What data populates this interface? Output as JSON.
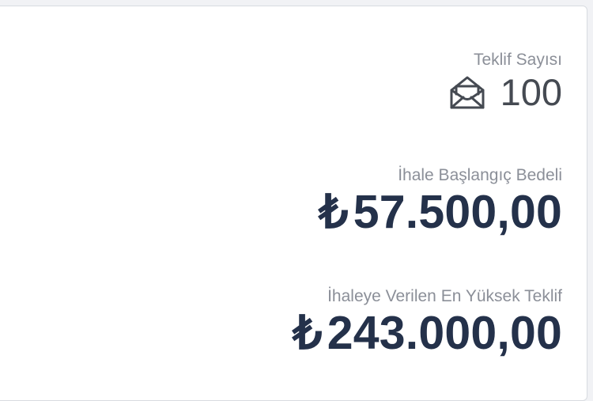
{
  "stats": {
    "offer_count": {
      "label": "Teklif Sayısı",
      "value": "100",
      "icon": "envelope-open-icon"
    },
    "starting_price": {
      "label": "İhale Başlangıç Bedeli",
      "currency": "₺",
      "value": "57.500,00"
    },
    "highest_offer": {
      "label": "İhaleye Verilen En Yüksek Teklif",
      "currency": "₺",
      "value": "243.000,00"
    }
  },
  "colors": {
    "label": "#8b8f98",
    "count": "#454a52",
    "money": "#24314a",
    "card_border": "#d8dbe0"
  }
}
